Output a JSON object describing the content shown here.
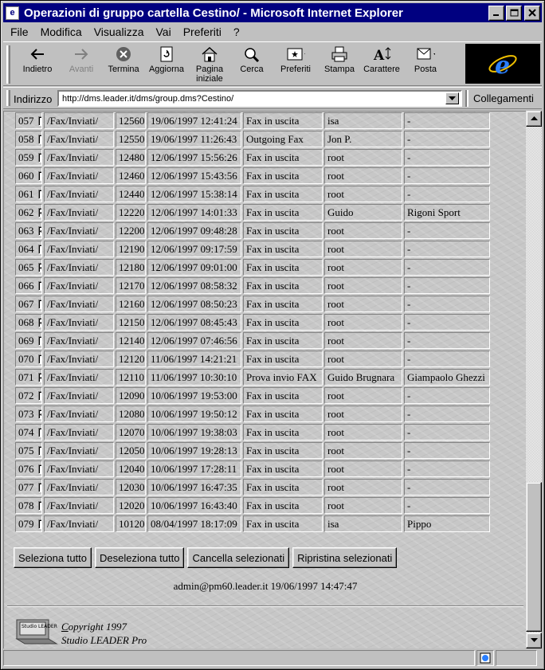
{
  "window": {
    "title": "Operazioni di gruppo cartella Cestino/  - Microsoft Internet Explorer",
    "minimize": "_",
    "maximize": "□",
    "close": "✕"
  },
  "menu": [
    "File",
    "Modifica",
    "Visualizza",
    "Vai",
    "Preferiti",
    "?"
  ],
  "toolbar": {
    "back": "Indietro",
    "forward": "Avanti",
    "stop": "Termina",
    "refresh": "Aggiorna",
    "home_line1": "Pagina",
    "home_line2": "iniziale",
    "search": "Cerca",
    "favorites": "Preferiti",
    "print": "Stampa",
    "font": "Carattere",
    "mail": "Posta"
  },
  "address": {
    "label": "Indirizzo",
    "url": "http://dms.leader.it/dms/group.dms?Cestino/",
    "links": "Collegamenti"
  },
  "rows": [
    {
      "n": "057",
      "c": false,
      "folder": "/Fax/Inviati/",
      "id": "12560",
      "date": "19/06/1997 12:41:24",
      "subject": "Fax in uscita",
      "user": "isa",
      "dest": "-"
    },
    {
      "n": "058",
      "c": false,
      "folder": "/Fax/Inviati/",
      "id": "12550",
      "date": "19/06/1997 11:26:43",
      "subject": "Outgoing Fax",
      "user": "Jon P.",
      "dest": "-"
    },
    {
      "n": "059",
      "c": false,
      "folder": "/Fax/Inviati/",
      "id": "12480",
      "date": "12/06/1997 15:56:26",
      "subject": "Fax in uscita",
      "user": "root",
      "dest": "-"
    },
    {
      "n": "060",
      "c": false,
      "folder": "/Fax/Inviati/",
      "id": "12460",
      "date": "12/06/1997 15:43:56",
      "subject": "Fax in uscita",
      "user": "root",
      "dest": "-"
    },
    {
      "n": "061",
      "c": false,
      "folder": "/Fax/Inviati/",
      "id": "12440",
      "date": "12/06/1997 15:38:14",
      "subject": "Fax in uscita",
      "user": "root",
      "dest": "-"
    },
    {
      "n": "062",
      "c": true,
      "folder": "/Fax/Inviati/",
      "id": "12220",
      "date": "12/06/1997 14:01:33",
      "subject": "Fax in uscita",
      "user": "Guido",
      "dest": "Rigoni Sport"
    },
    {
      "n": "063",
      "c": true,
      "folder": "/Fax/Inviati/",
      "id": "12200",
      "date": "12/06/1997 09:48:28",
      "subject": "Fax in uscita",
      "user": "root",
      "dest": "-"
    },
    {
      "n": "064",
      "c": false,
      "folder": "/Fax/Inviati/",
      "id": "12190",
      "date": "12/06/1997 09:17:59",
      "subject": "Fax in uscita",
      "user": "root",
      "dest": "-"
    },
    {
      "n": "065",
      "c": true,
      "folder": "/Fax/Inviati/",
      "id": "12180",
      "date": "12/06/1997 09:01:00",
      "subject": "Fax in uscita",
      "user": "root",
      "dest": "-"
    },
    {
      "n": "066",
      "c": false,
      "folder": "/Fax/Inviati/",
      "id": "12170",
      "date": "12/06/1997 08:58:32",
      "subject": "Fax in uscita",
      "user": "root",
      "dest": "-"
    },
    {
      "n": "067",
      "c": false,
      "folder": "/Fax/Inviati/",
      "id": "12160",
      "date": "12/06/1997 08:50:23",
      "subject": "Fax in uscita",
      "user": "root",
      "dest": "-"
    },
    {
      "n": "068",
      "c": true,
      "folder": "/Fax/Inviati/",
      "id": "12150",
      "date": "12/06/1997 08:45:43",
      "subject": "Fax in uscita",
      "user": "root",
      "dest": "-"
    },
    {
      "n": "069",
      "c": false,
      "folder": "/Fax/Inviati/",
      "id": "12140",
      "date": "12/06/1997 07:46:56",
      "subject": "Fax in uscita",
      "user": "root",
      "dest": "-"
    },
    {
      "n": "070",
      "c": false,
      "folder": "/Fax/Inviati/",
      "id": "12120",
      "date": "11/06/1997 14:21:21",
      "subject": "Fax in uscita",
      "user": "root",
      "dest": "-"
    },
    {
      "n": "071",
      "c": true,
      "folder": "/Fax/Inviati/",
      "id": "12110",
      "date": "11/06/1997 10:30:10",
      "subject": "Prova invio FAX",
      "user": "Guido Brugnara",
      "dest": "Giampaolo Ghezzi"
    },
    {
      "n": "072",
      "c": false,
      "folder": "/Fax/Inviati/",
      "id": "12090",
      "date": "10/06/1997 19:53:00",
      "subject": "Fax in uscita",
      "user": "root",
      "dest": "-"
    },
    {
      "n": "073",
      "c": true,
      "folder": "/Fax/Inviati/",
      "id": "12080",
      "date": "10/06/1997 19:50:12",
      "subject": "Fax in uscita",
      "user": "root",
      "dest": "-"
    },
    {
      "n": "074",
      "c": false,
      "folder": "/Fax/Inviati/",
      "id": "12070",
      "date": "10/06/1997 19:38:03",
      "subject": "Fax in uscita",
      "user": "root",
      "dest": "-"
    },
    {
      "n": "075",
      "c": false,
      "folder": "/Fax/Inviati/",
      "id": "12050",
      "date": "10/06/1997 19:28:13",
      "subject": "Fax in uscita",
      "user": "root",
      "dest": "-"
    },
    {
      "n": "076",
      "c": false,
      "folder": "/Fax/Inviati/",
      "id": "12040",
      "date": "10/06/1997 17:28:11",
      "subject": "Fax in uscita",
      "user": "root",
      "dest": "-"
    },
    {
      "n": "077",
      "c": false,
      "folder": "/Fax/Inviati/",
      "id": "12030",
      "date": "10/06/1997 16:47:35",
      "subject": "Fax in uscita",
      "user": "root",
      "dest": "-"
    },
    {
      "n": "078",
      "c": false,
      "folder": "/Fax/Inviati/",
      "id": "12020",
      "date": "10/06/1997 16:43:40",
      "subject": "Fax in uscita",
      "user": "root",
      "dest": "-"
    },
    {
      "n": "079",
      "c": false,
      "folder": "/Fax/Inviati/",
      "id": "10120",
      "date": "08/04/1997 18:17:09",
      "subject": "Fax in uscita",
      "user": "isa",
      "dest": "Pippo"
    }
  ],
  "buttons": {
    "select_all": "Seleziona tutto",
    "deselect_all": "Deseleziona tutto",
    "delete_selected": "Cancella selezionati",
    "restore_selected": "Ripristina selezionati"
  },
  "footer": {
    "user_info": "admin@pm60.leader.it 19/06/1997 14:47:47",
    "copyright_c": "C",
    "copyright_rest": "opyright 1997",
    "company": "Studio LEADER Pro",
    "logo_text": "Studio LEADER"
  },
  "icons": {
    "back": "back-arrow-icon",
    "forward": "forward-arrow-icon",
    "stop": "stop-icon",
    "refresh": "refresh-icon",
    "home": "home-icon",
    "search": "search-icon",
    "favorites": "favorites-icon",
    "print": "print-icon",
    "font": "font-icon",
    "mail": "mail-icon"
  },
  "colors": {
    "titlebar": "#000080",
    "face": "#c0c0c0"
  }
}
